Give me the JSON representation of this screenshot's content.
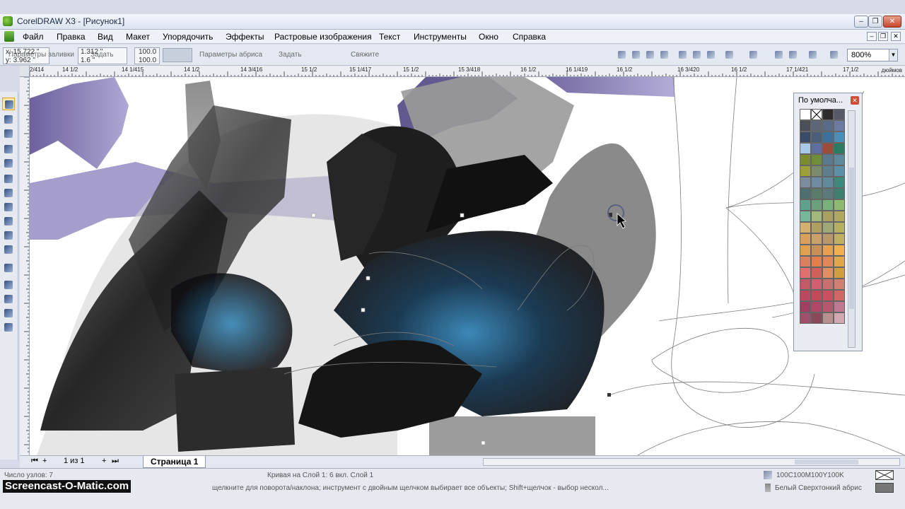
{
  "window": {
    "title": "CorelDRAW X3 - [Рисунок1]"
  },
  "menu": [
    {
      "label": "Файл"
    },
    {
      "label": "Правка"
    },
    {
      "label": "Вид"
    },
    {
      "label": "Макет"
    },
    {
      "label": "Упорядочить"
    },
    {
      "label": "Эффекты"
    },
    {
      "label": "Растровые изображения"
    },
    {
      "label": "Текст"
    },
    {
      "label": "Инструменты"
    },
    {
      "label": "Окно"
    },
    {
      "label": "Справка"
    }
  ],
  "propbar": {
    "x_label": "x:",
    "x_value": "15.722 \"",
    "y_label": "y:",
    "y_value": "3.962 \"",
    "fill_params": "Параметры заливки",
    "size_1": "1.312 \"",
    "size_2": "1.6 \"",
    "set_label": "Задать",
    "scale_1": "100.0",
    "scale_2": "100.0",
    "outline_params": "Параметры абриса",
    "set_label_2": "Задать",
    "ghost_label": "Свяжите",
    "zoom": "800%"
  },
  "ruler": {
    "labels": [
      "2/414",
      "14 1/2",
      "14 1/415",
      "14 1/2",
      "14 3/416",
      "15 1/2",
      "15 1/417",
      "15 1/2",
      "15 3/418",
      "16 1/2",
      "16 1/419",
      "16 1/2",
      "16 3/420",
      "16 1/2",
      "17 1/421",
      "17 1/2"
    ],
    "units": "дюймов"
  },
  "palette": {
    "title": "По умолча...",
    "colors": [
      "#ffffff",
      "#ffffff",
      "#2c2c2c",
      "#555a66",
      "#4a4f58",
      "#5c6677",
      "#5a6a86",
      "#6a7aa0",
      "#3a4b66",
      "#4b5f7a",
      "#3d6f9f",
      "#4a8fb8",
      "#a8c8e6",
      "#5d6fa0",
      "#9b4d3c",
      "#2d7a62",
      "#7a8c2f",
      "#6e8c3a",
      "#5a7a8c",
      "#5c8a9c",
      "#9aa13a",
      "#7a8c6c",
      "#5f7f8f",
      "#5b90a8",
      "#7c8c9c",
      "#6d8ca0",
      "#5f8b9a",
      "#3c8a7a",
      "#4d6f6f",
      "#5a7a6a",
      "#5c7a7a",
      "#3f7f6f",
      "#5fa08f",
      "#6aa07a",
      "#7ab07a",
      "#8fb870",
      "#78b89a",
      "#a0b87a",
      "#a8a060",
      "#b0a860",
      "#d4b070",
      "#b0a060",
      "#a0a878",
      "#b4b060",
      "#d8a058",
      "#c8a068",
      "#b89868",
      "#c0b060",
      "#e0a050",
      "#c89058",
      "#e8a050",
      "#f0b050",
      "#d88060",
      "#e08048",
      "#e08858",
      "#e0a848",
      "#e07070",
      "#d06058",
      "#e09060",
      "#d0a040",
      "#c05a68",
      "#d06070",
      "#c87070",
      "#d08070",
      "#b84a60",
      "#c04a58",
      "#c85060",
      "#d06868",
      "#a04060",
      "#b04868",
      "#b85870",
      "#c07890",
      "#a05068",
      "#8a4858",
      "#b89090",
      "#d0a8b0"
    ]
  },
  "pagebar": {
    "first": "⏮",
    "add_before": "+",
    "page_counter": "1 из 1",
    "add_after": "+",
    "last": "⏭",
    "page_tab": "Страница 1"
  },
  "status": {
    "nodes": "Число узлов: 7",
    "curve_info": "Кривая вкл. Слой 1",
    "curve_info_2": "Кривая на Слой 1: 6 вкл. Слой 1",
    "hint": "щелкните для поворота/наклона; инструмент с двойным щелчком выбирает все объекты; Shift+щелчок - выбор нескол...",
    "fill_color": "100C100M100Y100K",
    "outline_desc": "Белый  Сверхтонкий абрис"
  },
  "watermark": "Screencast-O-Matic.com",
  "colors": {
    "title_bar": "#dbe4f1",
    "accent_purple": "#6a5c9e",
    "canvas": "#ffffff"
  }
}
